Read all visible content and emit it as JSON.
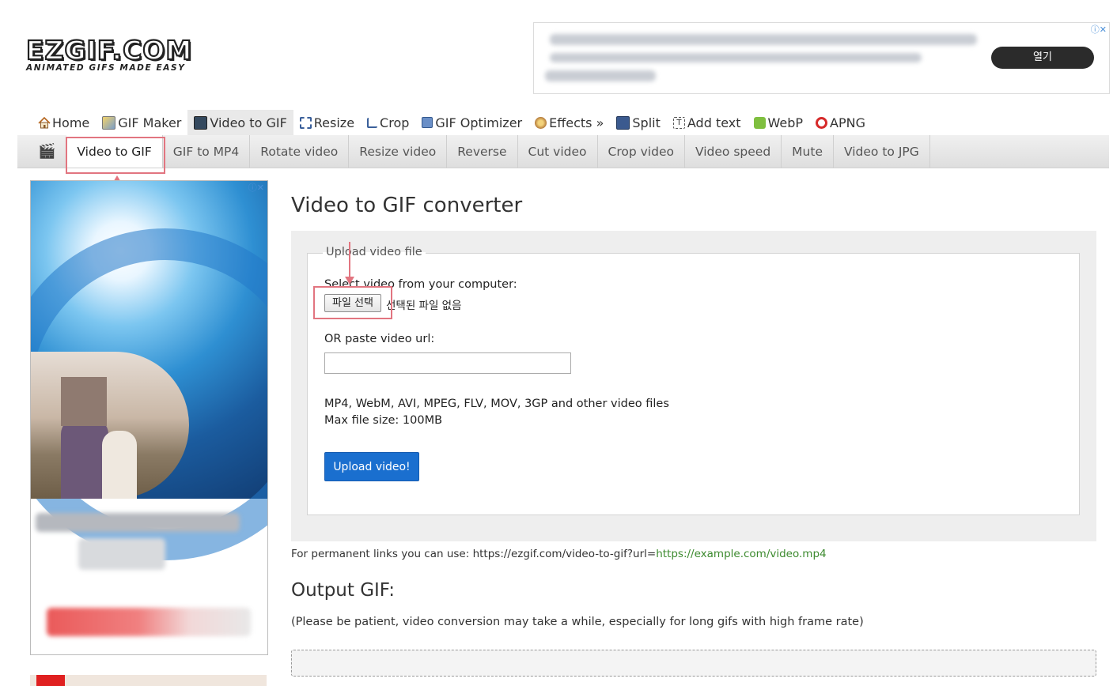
{
  "logo": {
    "main": "EZGIF.COM",
    "tagline": "ANIMATED GIFS MADE EASY"
  },
  "top_ad": {
    "button_label": "열기",
    "adchoice": "ⓘ✕"
  },
  "main_nav": [
    {
      "label": "Home",
      "icon": "home-icon",
      "active": false
    },
    {
      "label": "GIF Maker",
      "icon": "gif-maker-icon",
      "active": false
    },
    {
      "label": "Video to GIF",
      "icon": "film-icon",
      "active": true
    },
    {
      "label": "Resize",
      "icon": "resize-icon",
      "active": false
    },
    {
      "label": "Crop",
      "icon": "crop-icon",
      "active": false
    },
    {
      "label": "GIF Optimizer",
      "icon": "optimizer-icon",
      "active": false
    },
    {
      "label": "Effects »",
      "icon": "effects-icon",
      "active": false
    },
    {
      "label": "Split",
      "icon": "split-icon",
      "active": false
    },
    {
      "label": "Add text",
      "icon": "add-text-icon",
      "active": false
    },
    {
      "label": "WebP",
      "icon": "webp-icon",
      "active": false
    },
    {
      "label": "APNG",
      "icon": "apng-icon",
      "active": false
    }
  ],
  "sub_nav": {
    "icon": "clapperboard-icon",
    "items": [
      {
        "label": "Video to GIF",
        "active": true
      },
      {
        "label": "GIF to MP4",
        "active": false
      },
      {
        "label": "Rotate video",
        "active": false
      },
      {
        "label": "Resize video",
        "active": false
      },
      {
        "label": "Reverse",
        "active": false
      },
      {
        "label": "Cut video",
        "active": false
      },
      {
        "label": "Crop video",
        "active": false
      },
      {
        "label": "Video speed",
        "active": false
      },
      {
        "label": "Mute",
        "active": false
      },
      {
        "label": "Video to JPG",
        "active": false
      }
    ]
  },
  "left_ad": {
    "adchoice": "ⓘ✕"
  },
  "page": {
    "title": "Video to GIF converter",
    "upload_legend": "Upload video file",
    "select_label": "Select video from your computer:",
    "file_button": "파일 선택",
    "file_status": "선택된 파일 없음",
    "url_label": "OR paste video url:",
    "url_value": "",
    "formats": "MP4, WebM, AVI, MPEG, FLV, MOV, 3GP and other video files",
    "max_size": "Max file size: 100MB",
    "upload_button": "Upload video!",
    "perm_prefix": "For permanent links you can use: https://ezgif.com/video-to-gif?url=",
    "perm_url": "https://example.com/video.mp4",
    "output_title": "Output GIF:",
    "output_note": "(Please be patient, video conversion may take a while, especially for long gifs with high frame rate)"
  },
  "colors": {
    "highlight": "#e27580",
    "upload_button": "#1a6fcf",
    "link_green": "#3c8a2e"
  }
}
